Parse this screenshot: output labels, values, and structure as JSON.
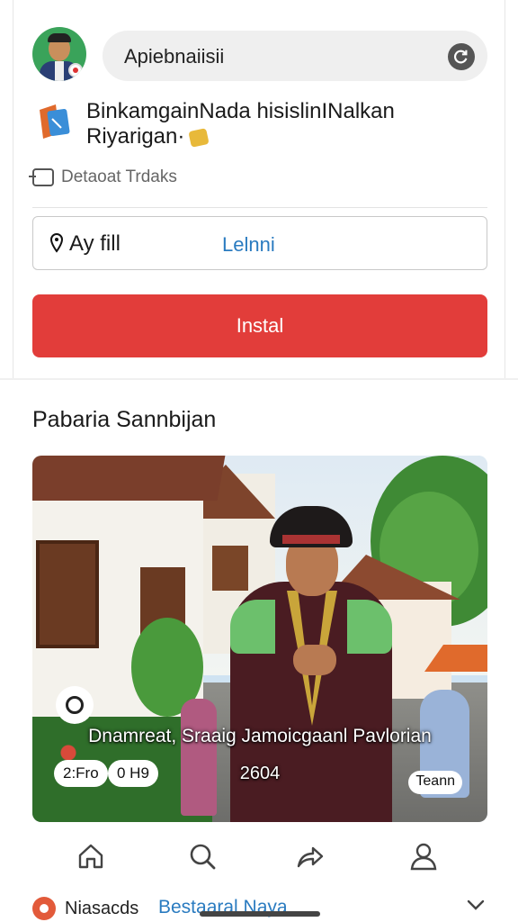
{
  "header": {
    "search_text": "Apiebnaiisii",
    "title": "BinkamgainNada hisislinINalkan Riyarigan·",
    "meta_label": "Detaoat Trdaks"
  },
  "location": {
    "label": "Ay fill",
    "link": "Lelnni"
  },
  "install_label": "Instal",
  "section": {
    "title": "Pabaria Sannbijan"
  },
  "photo": {
    "caption": "Dnamreat, Sraaig Jamoicgaanl Pavlorian",
    "date": "2604",
    "chip_left_1": "2:Fro",
    "chip_left_2": "0 H9",
    "chip_right": "Teann"
  },
  "nav": {
    "items": [
      "home-icon",
      "search-icon",
      "share-icon",
      "profile-icon"
    ]
  },
  "bottom": {
    "label": "Niasacds",
    "link": "Bestaaral Naya"
  },
  "colors": {
    "accent_red": "#e23d3a",
    "link_blue": "#2a7bc0"
  }
}
